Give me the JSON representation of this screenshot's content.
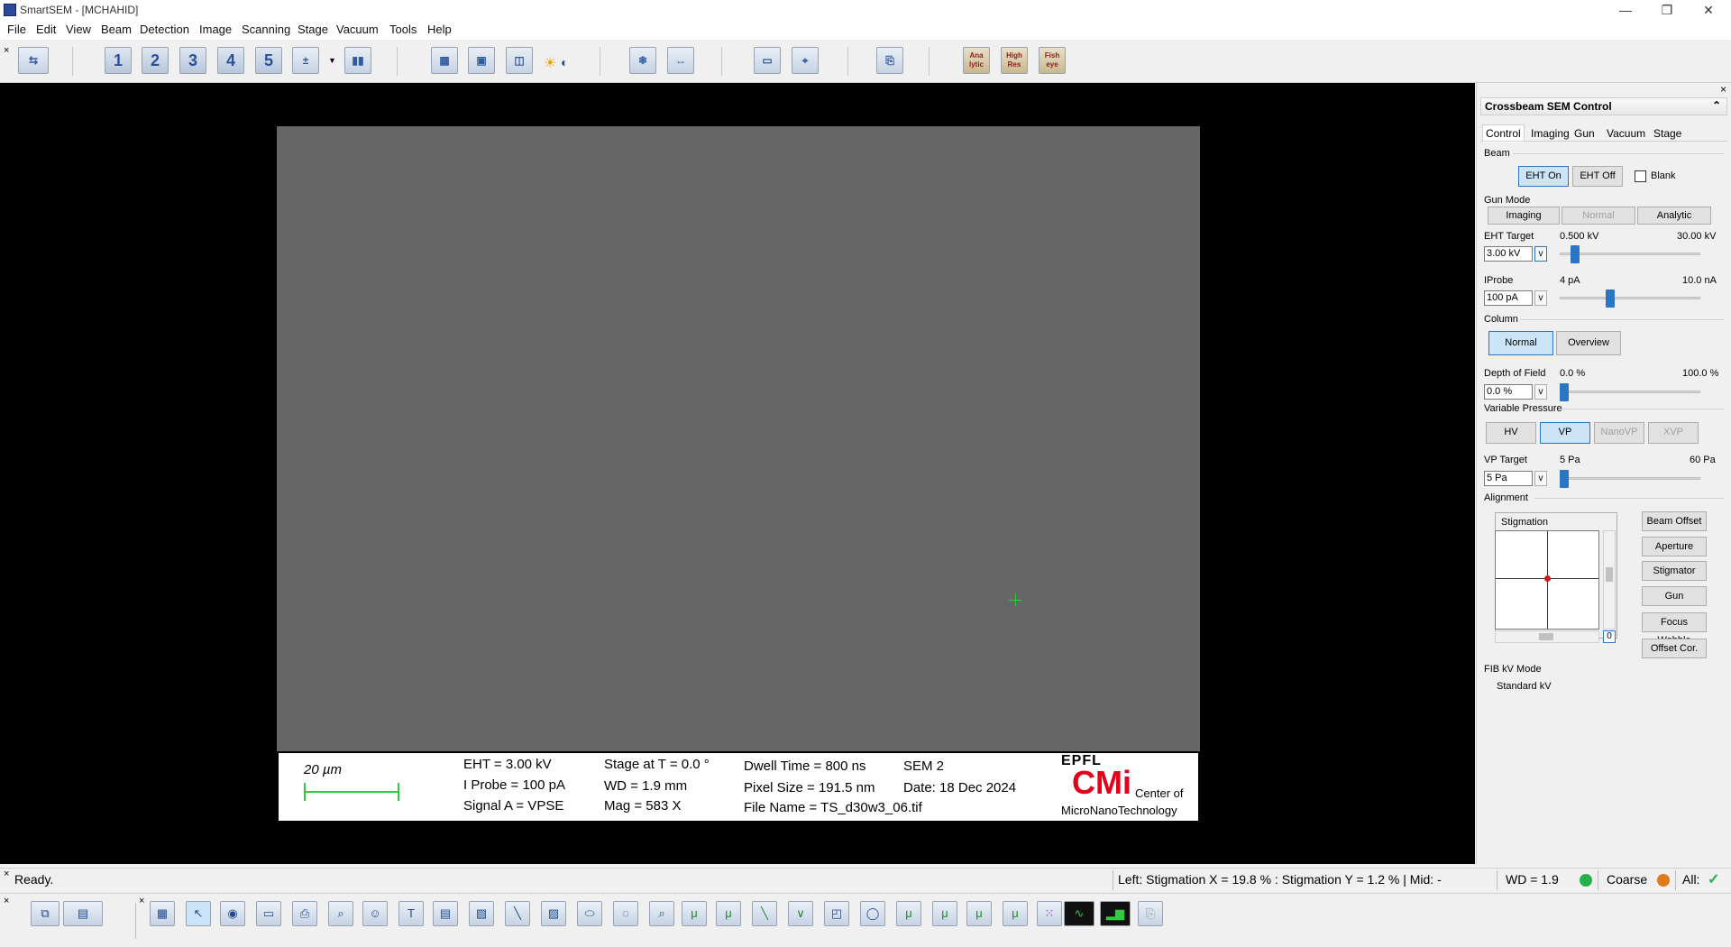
{
  "window": {
    "title": "SmartSEM - [MCHAHID]",
    "minimize": "—",
    "restore": "❐",
    "close": "✕"
  },
  "menu": [
    "File",
    "Edit",
    "View",
    "Beam",
    "Detection",
    "Image",
    "Scanning",
    "Stage",
    "Vacuum",
    "Tools",
    "Help"
  ],
  "toolbar": {
    "presets": [
      "1",
      "2",
      "3",
      "4",
      "5"
    ],
    "analytic": "Ana lytic",
    "high_res": "High Res",
    "fish_eye": "Fish eye"
  },
  "image": {
    "databar": {
      "scale": "20 µm",
      "eht": "EHT =  3.00 kV",
      "iprobe": "I Probe =     100 pA",
      "signal": "Signal A = VPSE",
      "stage": "Stage at T =    0.0 °",
      "wd": "WD =  1.9 mm",
      "mag": "Mag =     583 X",
      "dwell": "Dwell Time = 800 ns",
      "pixel": "Pixel Size = 191.5 nm",
      "file": "File Name = TS_d30w3_06.tif",
      "sem": "SEM 2",
      "date": "Date: 18 Dec 2024",
      "logo_epfl": "EPFL",
      "logo_cmi": "CMi",
      "logo_center": "Center of",
      "logo_mnt": "MicroNanoTechnology"
    }
  },
  "panel": {
    "title": "Crossbeam SEM Control",
    "close": "×",
    "collapse": "⌃",
    "tabs": [
      "Control",
      "Imaging",
      "Gun",
      "Vacuum",
      "Stage"
    ],
    "beam_label": "Beam",
    "eht_on": "EHT On",
    "eht_off": "EHT Off",
    "blank": "Blank",
    "gun_mode_label": "Gun Mode",
    "gun_modes": [
      "Imaging",
      "Normal",
      "Analytic"
    ],
    "eht_target_label": "EHT Target",
    "eht_min": "0.500 kV",
    "eht_max": "30.00 kV",
    "eht_value": "3.00 kV",
    "eht_level": 0.085,
    "iprobe_label": "IProbe",
    "iprobe_min": "4 pA",
    "iprobe_max": "10.0 nA",
    "iprobe_value": "100 pA",
    "iprobe_level": 0.35,
    "column_label": "Column",
    "column_normal": "Normal",
    "column_overview": "Overview",
    "dof_label": "Depth of Field",
    "dof_min": "0.0 %",
    "dof_max": "100.0 %",
    "dof_value": "0.0 %",
    "dof_level": 0.0,
    "vp_label": "Variable Pressure",
    "vp_modes": [
      "HV",
      "VP",
      "NanoVP",
      "XVP"
    ],
    "vp_target_label": "VP Target",
    "vp_min": "5 Pa",
    "vp_max": "60 Pa",
    "vp_value": "5 Pa",
    "vp_level": 0.0,
    "alignment_label": "Alignment",
    "stigmation_label": "Stigmation",
    "stig_counter": "0",
    "align_buttons": [
      "Beam Offset",
      "Aperture",
      "Stigmator",
      "Gun",
      "Focus Wobble",
      "Offset Cor."
    ],
    "fib_label": "FIB kV Mode",
    "fib_value": "Standard kV",
    "dropdown": "v"
  },
  "status": {
    "ready": "Ready.",
    "stig": "Left: Stigmation X =  19.8 % : Stigmation Y =    1.2 % | Mid: -",
    "wd": "WD =  1.9",
    "coarse": "Coarse",
    "all": "All:",
    "colors": {
      "wd": "#22b14c",
      "coarse": "#e07b16",
      "all": "#22b14c"
    }
  }
}
